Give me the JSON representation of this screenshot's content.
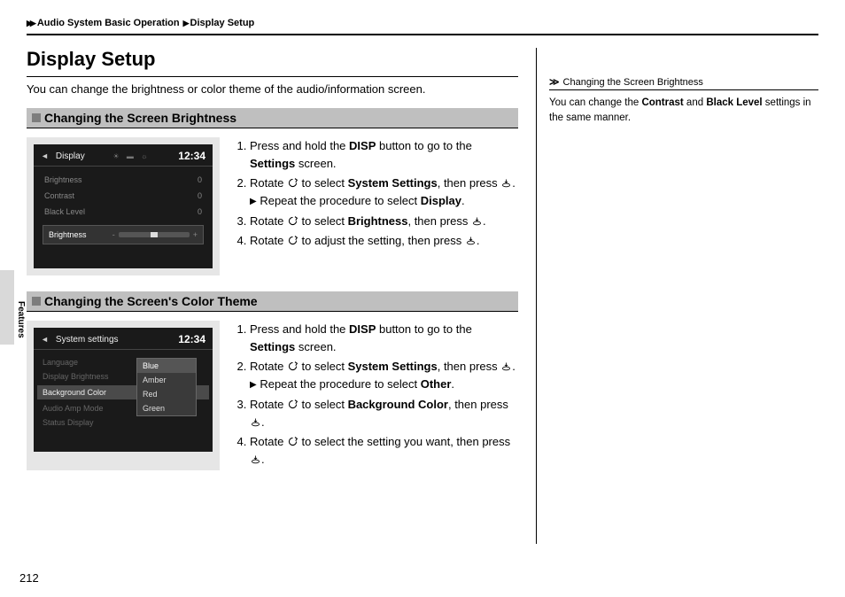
{
  "breadcrumb": {
    "level1": "Audio System Basic Operation",
    "level2": "Display Setup"
  },
  "page_title": "Display Setup",
  "intro": "You can change the brightness or color theme of the audio/information screen.",
  "side_tab": "Features",
  "page_number": "212",
  "section1": {
    "heading": "Changing the Screen Brightness",
    "screen": {
      "title": "Display",
      "clock": "12:34",
      "rows": [
        {
          "label": "Brightness",
          "val": "0"
        },
        {
          "label": "Contrast",
          "val": "0"
        },
        {
          "label": "Black Level",
          "val": "0"
        }
      ],
      "selected": "Brightness"
    },
    "steps": {
      "s1a": "Press and hold the ",
      "s1b": "DISP",
      "s1c": " button to go to the ",
      "s1d": "Settings",
      "s1e": " screen.",
      "s2a": "Rotate ",
      "s2b": " to select ",
      "s2c": "System Settings",
      "s2d": ", then press ",
      "s2e": ".",
      "s2f": "Repeat the procedure to select ",
      "s2g": "Display",
      "s2h": ".",
      "s3a": "Rotate ",
      "s3b": " to select ",
      "s3c": "Brightness",
      "s3d": ", then press ",
      "s3e": ".",
      "s4a": "Rotate ",
      "s4b": " to adjust the setting, then press ",
      "s4c": "."
    }
  },
  "section2": {
    "heading": "Changing the Screen's Color Theme",
    "screen": {
      "title": "System settings",
      "clock": "12:34",
      "left": [
        "Language",
        "Display Brightness",
        "Background Color",
        "Audio Amp Mode",
        "Status Display"
      ],
      "options": [
        "Blue",
        "Amber",
        "Red",
        "Green"
      ]
    },
    "steps": {
      "s1a": "Press and hold the ",
      "s1b": "DISP",
      "s1c": " button to go to the ",
      "s1d": "Settings",
      "s1e": " screen.",
      "s2a": "Rotate ",
      "s2b": " to select ",
      "s2c": "System Settings",
      "s2d": ", then press ",
      "s2e": ".",
      "s2f": "Repeat the procedure to select ",
      "s2g": "Other",
      "s2h": ".",
      "s3a": "Rotate ",
      "s3b": " to select ",
      "s3c": "Background Color",
      "s3d": ", then press ",
      "s3e": ".",
      "s4a": "Rotate ",
      "s4b": " to select the setting you want, then press ",
      "s4c": "."
    }
  },
  "sidebar": {
    "note_title": "Changing the Screen Brightness",
    "body_a": "You can change the ",
    "body_b": "Contrast",
    "body_c": " and ",
    "body_d": "Black Level",
    "body_e": " settings in the same manner."
  }
}
